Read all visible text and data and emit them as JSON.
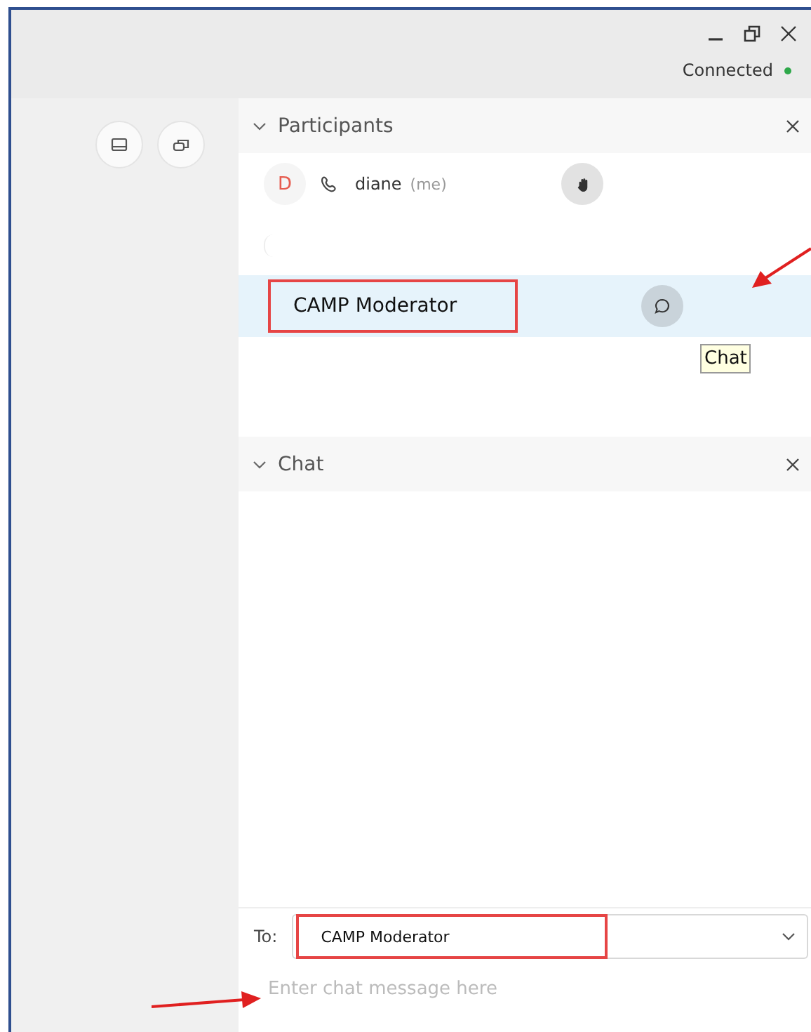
{
  "status": {
    "text": "Connected",
    "connected": true
  },
  "participants_panel": {
    "title": "Participants",
    "expanded": true,
    "participants": [
      {
        "kind": "self",
        "initial": "D",
        "name": "diane",
        "note": "(me)",
        "selected": false
      },
      {
        "kind": "other",
        "name": "CAMP Moderator",
        "selected": true,
        "tooltip": "Chat"
      }
    ]
  },
  "chat_panel": {
    "title": "Chat",
    "expanded": true,
    "to_label": "To:",
    "recipient": "CAMP Moderator",
    "placeholder": "Enter chat message here"
  }
}
